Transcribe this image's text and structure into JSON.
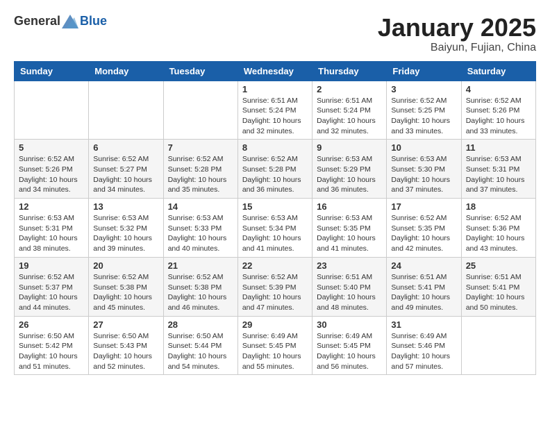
{
  "header": {
    "logo": {
      "general": "General",
      "blue": "Blue"
    },
    "title": "January 2025",
    "subtitle": "Baiyun, Fujian, China"
  },
  "weekdays": [
    "Sunday",
    "Monday",
    "Tuesday",
    "Wednesday",
    "Thursday",
    "Friday",
    "Saturday"
  ],
  "weeks": [
    [
      {
        "day": "",
        "info": ""
      },
      {
        "day": "",
        "info": ""
      },
      {
        "day": "",
        "info": ""
      },
      {
        "day": "1",
        "info": "Sunrise: 6:51 AM\nSunset: 5:24 PM\nDaylight: 10 hours\nand 32 minutes."
      },
      {
        "day": "2",
        "info": "Sunrise: 6:51 AM\nSunset: 5:24 PM\nDaylight: 10 hours\nand 32 minutes."
      },
      {
        "day": "3",
        "info": "Sunrise: 6:52 AM\nSunset: 5:25 PM\nDaylight: 10 hours\nand 33 minutes."
      },
      {
        "day": "4",
        "info": "Sunrise: 6:52 AM\nSunset: 5:26 PM\nDaylight: 10 hours\nand 33 minutes."
      }
    ],
    [
      {
        "day": "5",
        "info": "Sunrise: 6:52 AM\nSunset: 5:26 PM\nDaylight: 10 hours\nand 34 minutes."
      },
      {
        "day": "6",
        "info": "Sunrise: 6:52 AM\nSunset: 5:27 PM\nDaylight: 10 hours\nand 34 minutes."
      },
      {
        "day": "7",
        "info": "Sunrise: 6:52 AM\nSunset: 5:28 PM\nDaylight: 10 hours\nand 35 minutes."
      },
      {
        "day": "8",
        "info": "Sunrise: 6:52 AM\nSunset: 5:28 PM\nDaylight: 10 hours\nand 36 minutes."
      },
      {
        "day": "9",
        "info": "Sunrise: 6:53 AM\nSunset: 5:29 PM\nDaylight: 10 hours\nand 36 minutes."
      },
      {
        "day": "10",
        "info": "Sunrise: 6:53 AM\nSunset: 5:30 PM\nDaylight: 10 hours\nand 37 minutes."
      },
      {
        "day": "11",
        "info": "Sunrise: 6:53 AM\nSunset: 5:31 PM\nDaylight: 10 hours\nand 37 minutes."
      }
    ],
    [
      {
        "day": "12",
        "info": "Sunrise: 6:53 AM\nSunset: 5:31 PM\nDaylight: 10 hours\nand 38 minutes."
      },
      {
        "day": "13",
        "info": "Sunrise: 6:53 AM\nSunset: 5:32 PM\nDaylight: 10 hours\nand 39 minutes."
      },
      {
        "day": "14",
        "info": "Sunrise: 6:53 AM\nSunset: 5:33 PM\nDaylight: 10 hours\nand 40 minutes."
      },
      {
        "day": "15",
        "info": "Sunrise: 6:53 AM\nSunset: 5:34 PM\nDaylight: 10 hours\nand 41 minutes."
      },
      {
        "day": "16",
        "info": "Sunrise: 6:53 AM\nSunset: 5:35 PM\nDaylight: 10 hours\nand 41 minutes."
      },
      {
        "day": "17",
        "info": "Sunrise: 6:52 AM\nSunset: 5:35 PM\nDaylight: 10 hours\nand 42 minutes."
      },
      {
        "day": "18",
        "info": "Sunrise: 6:52 AM\nSunset: 5:36 PM\nDaylight: 10 hours\nand 43 minutes."
      }
    ],
    [
      {
        "day": "19",
        "info": "Sunrise: 6:52 AM\nSunset: 5:37 PM\nDaylight: 10 hours\nand 44 minutes."
      },
      {
        "day": "20",
        "info": "Sunrise: 6:52 AM\nSunset: 5:38 PM\nDaylight: 10 hours\nand 45 minutes."
      },
      {
        "day": "21",
        "info": "Sunrise: 6:52 AM\nSunset: 5:38 PM\nDaylight: 10 hours\nand 46 minutes."
      },
      {
        "day": "22",
        "info": "Sunrise: 6:52 AM\nSunset: 5:39 PM\nDaylight: 10 hours\nand 47 minutes."
      },
      {
        "day": "23",
        "info": "Sunrise: 6:51 AM\nSunset: 5:40 PM\nDaylight: 10 hours\nand 48 minutes."
      },
      {
        "day": "24",
        "info": "Sunrise: 6:51 AM\nSunset: 5:41 PM\nDaylight: 10 hours\nand 49 minutes."
      },
      {
        "day": "25",
        "info": "Sunrise: 6:51 AM\nSunset: 5:41 PM\nDaylight: 10 hours\nand 50 minutes."
      }
    ],
    [
      {
        "day": "26",
        "info": "Sunrise: 6:50 AM\nSunset: 5:42 PM\nDaylight: 10 hours\nand 51 minutes."
      },
      {
        "day": "27",
        "info": "Sunrise: 6:50 AM\nSunset: 5:43 PM\nDaylight: 10 hours\nand 52 minutes."
      },
      {
        "day": "28",
        "info": "Sunrise: 6:50 AM\nSunset: 5:44 PM\nDaylight: 10 hours\nand 54 minutes."
      },
      {
        "day": "29",
        "info": "Sunrise: 6:49 AM\nSunset: 5:45 PM\nDaylight: 10 hours\nand 55 minutes."
      },
      {
        "day": "30",
        "info": "Sunrise: 6:49 AM\nSunset: 5:45 PM\nDaylight: 10 hours\nand 56 minutes."
      },
      {
        "day": "31",
        "info": "Sunrise: 6:49 AM\nSunset: 5:46 PM\nDaylight: 10 hours\nand 57 minutes."
      },
      {
        "day": "",
        "info": ""
      }
    ]
  ]
}
